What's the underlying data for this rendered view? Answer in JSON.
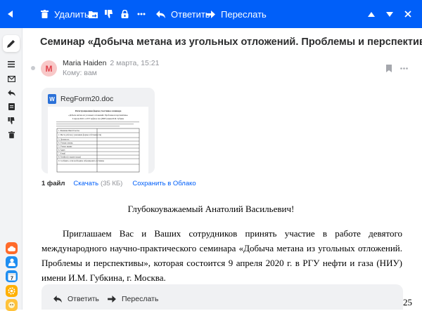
{
  "toolbar": {
    "delete_label": "Удалить",
    "reply_label": "Ответить",
    "forward_label": "Переслать"
  },
  "message": {
    "subject": "Семинар «Добыча метана из угольных отложений. Проблемы и перспективы»",
    "avatar_letter": "M",
    "sender_name": "Maria Haiden",
    "sender_date": "2 марта, 15:21",
    "to_line": "Кому: вам"
  },
  "attachment": {
    "filename": "RegForm20.doc",
    "file_type_letter": "W",
    "preview_title": "Регистрационная форма участника семинара",
    "preview_subtitle": "«Добыча метана из угольных отложений. Проблемы и перспективы»",
    "preview_date": "9 апреля 2020 г. в РГУ нефти и газа (НИУ) имени И.М. Губкина",
    "preview_rows": [
      "1. Фамилия Имя Отчество",
      "2. Место работы (с указанием формы собственности)",
      "3. Должность",
      "4. Ученая степень",
      "5. Ученое звание",
      "6. Адрес",
      "7. E-mail",
      "8. Телефон (с кодом города)",
      "9. Сообщите, если необходимо забронировать гостиницу"
    ],
    "count_label": "1 файл",
    "download_label": "Скачать",
    "size_label": "(35 КБ)",
    "save_cloud_label": "Сохранить в Облако"
  },
  "body": {
    "greeting": "Глубокоуважаемый Анатолий Васильевич!",
    "paragraph": "Приглашаем Вас и Ваших сотрудников принять участие в работе девятого международного научно-практического семинара «Добыча метана из угольных отложений. Проблемы и перспективы», которая состоится 9 апреля 2020 г. в РГУ нефти и газа (НИУ) имени И.М. Губкина, г. Москва.",
    "cut_text": "25"
  },
  "reply_bar": {
    "reply_label": "Ответить",
    "forward_label": "Переслать"
  },
  "colors": {
    "accent": "#005ff9",
    "avatar_bg": "#f8c8c8",
    "avatar_fg": "#e0404a",
    "doc_icon": "#2b71d8"
  },
  "icons": {
    "toolbar": [
      "back-arrow-icon",
      "trash-icon",
      "move-icon",
      "thumbs-down-icon",
      "lock-icon",
      "more-dots-icon",
      "reply-icon",
      "forward-icon",
      "up-arrow-icon",
      "down-arrow-icon",
      "close-icon"
    ],
    "sidebar": [
      "pencil-icon",
      "menu-icon",
      "envelope-icon",
      "reply-icon",
      "note-icon",
      "thumbs-down-icon",
      "trash-icon"
    ],
    "apps": [
      "cloud-app-icon",
      "contacts-app-icon",
      "calendar-app-icon",
      "settings-app-icon",
      "mascot-app-icon"
    ]
  }
}
